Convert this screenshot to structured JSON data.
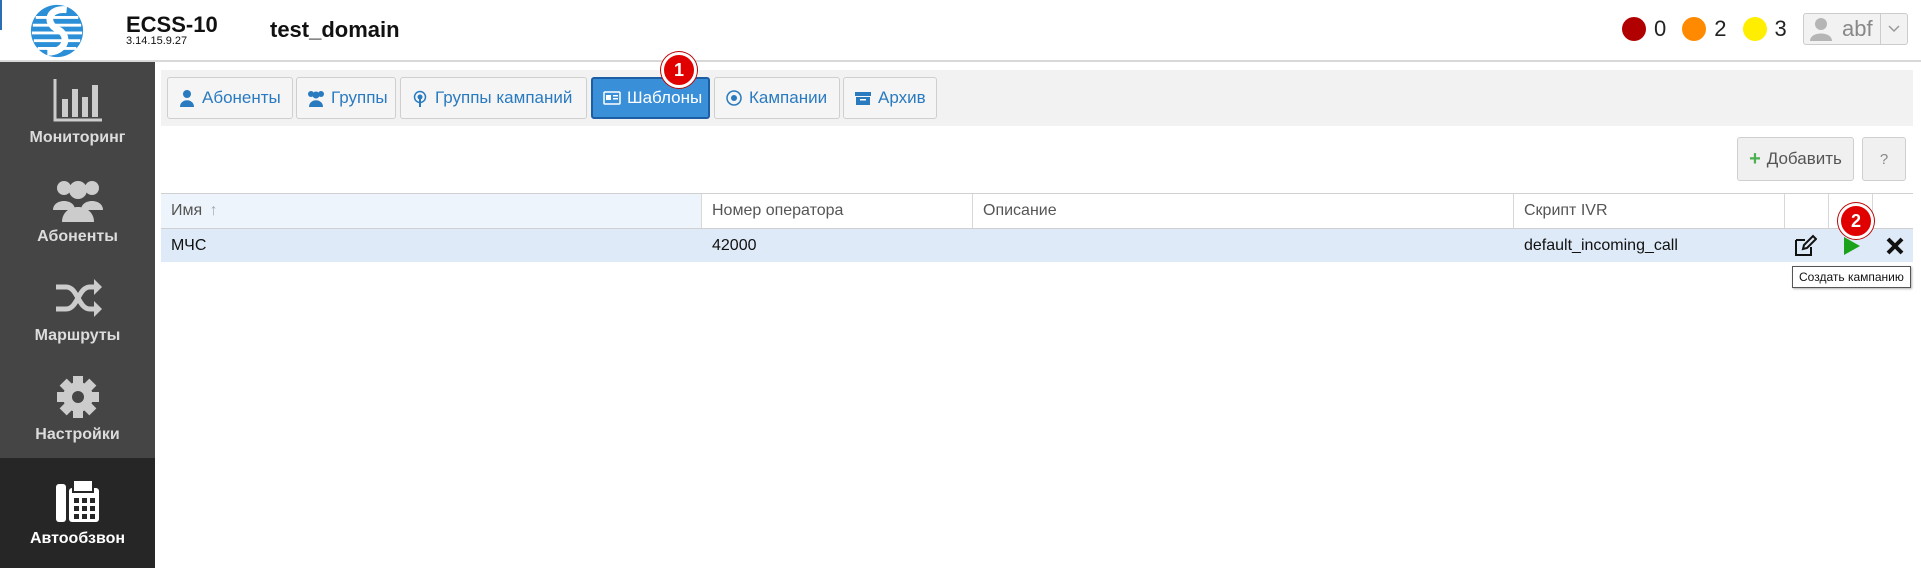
{
  "header": {
    "brand_name": "ECSS-10",
    "version": "3.14.15.9.27",
    "domain": "test_domain",
    "alarms": [
      {
        "color": "#b10000",
        "count": "0"
      },
      {
        "color": "#ff8a00",
        "count": "2"
      },
      {
        "color": "#ffee00",
        "count": "3"
      }
    ],
    "user": "abf"
  },
  "sidebar": {
    "items": [
      {
        "label": "Мониторинг",
        "icon": "bar-chart-icon"
      },
      {
        "label": "Абоненты",
        "icon": "users-icon"
      },
      {
        "label": "Маршруты",
        "icon": "shuffle-icon"
      },
      {
        "label": "Настройки",
        "icon": "gear-icon"
      },
      {
        "label": "Автообзвон",
        "icon": "fax-icon",
        "active": true
      }
    ]
  },
  "tabs": [
    {
      "label": "Абоненты",
      "icon": "user-icon"
    },
    {
      "label": "Группы",
      "icon": "users-icon"
    },
    {
      "label": "Группы кампаний",
      "icon": "broadcast-icon"
    },
    {
      "label": "Шаблоны",
      "icon": "id-card-icon",
      "active": true
    },
    {
      "label": "Кампании",
      "icon": "target-icon"
    },
    {
      "label": "Архив",
      "icon": "archive-icon"
    }
  ],
  "annotations": {
    "badge1": "1",
    "badge2": "2"
  },
  "toolbar": {
    "add_label": "Добавить",
    "help_label": "?"
  },
  "table": {
    "columns": [
      "Имя",
      "Номер оператора",
      "Описание",
      "Скрипт IVR"
    ],
    "sort_indicator": "↑",
    "rows": [
      {
        "name": "МЧС",
        "operator": "42000",
        "description": "",
        "script": "default_incoming_call"
      }
    ]
  },
  "tooltip": "Создать кампанию"
}
